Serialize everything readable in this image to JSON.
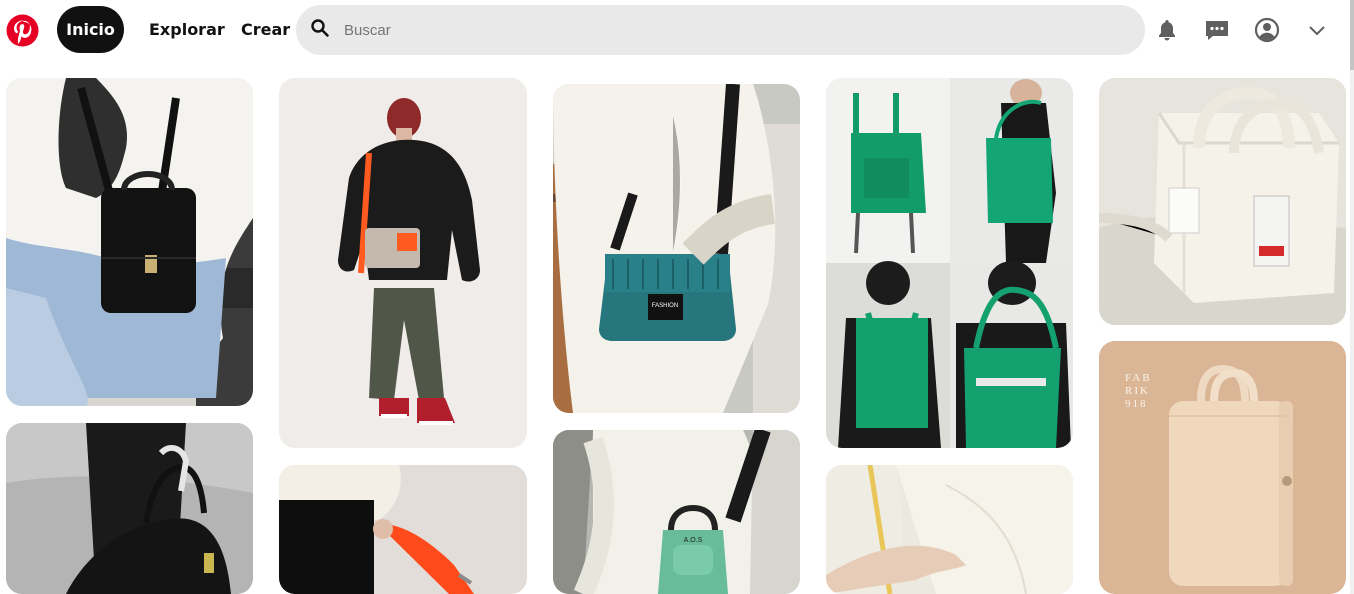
{
  "header": {
    "logo_icon": "pinterest-logo-icon",
    "nav": {
      "home_label": "Inicio",
      "explore_label": "Explorar",
      "create_label": "Crear"
    },
    "search": {
      "icon": "search-icon",
      "placeholder": "Buscar"
    },
    "icons": [
      "bell-icon",
      "chat-icon",
      "user-icon",
      "chevron-down-icon"
    ]
  },
  "colors": {
    "brand": "#e60023",
    "active_nav_bg": "#111111",
    "search_bg": "#e9e9e9"
  },
  "pins": [
    {
      "name": "pin-black-backpack-denim"
    },
    {
      "name": "pin-black-duffel-bag"
    },
    {
      "name": "pin-man-crossbody-orange-strap"
    },
    {
      "name": "pin-orange-strap-bag"
    },
    {
      "name": "pin-teal-corduroy-bag",
      "label": "FASHION"
    },
    {
      "name": "pin-green-mini-bag",
      "label": "A.O.S"
    },
    {
      "name": "pin-green-tote-collage"
    },
    {
      "name": "pin-yellow-strap-bag"
    },
    {
      "name": "pin-white-canvas-tote"
    },
    {
      "name": "pin-beige-leather-bag",
      "label": "FAB\nRIK\n918"
    }
  ]
}
